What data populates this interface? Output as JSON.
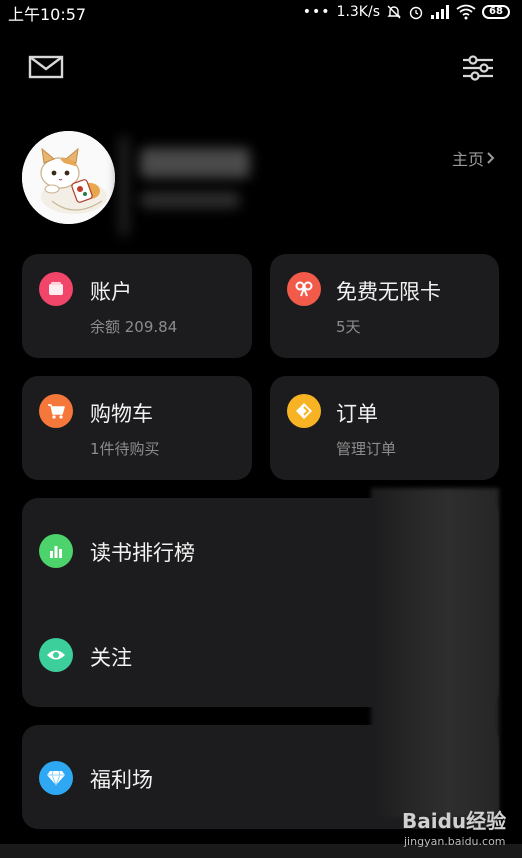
{
  "status_bar": {
    "time": "上午10:57",
    "network_speed": "1.3K/s",
    "battery": "68"
  },
  "header": {
    "homepage_label": "主页"
  },
  "cards": {
    "account": {
      "title": "账户",
      "subtitle": "余额 209.84",
      "color": "#f2456a"
    },
    "free_card": {
      "title": "免费无限卡",
      "subtitle": "5天",
      "color": "#f25a4a"
    },
    "cart": {
      "title": "购物车",
      "subtitle": "1件待购买",
      "color": "#f5773a"
    },
    "orders": {
      "title": "订单",
      "subtitle": "管理订单",
      "color": "#f7b324"
    }
  },
  "list": {
    "ranking": {
      "title": "读书排行榜",
      "color": "#4cd36b"
    },
    "follow": {
      "title": "关注",
      "color": "#3ccf9c"
    },
    "welfare": {
      "title": "福利场",
      "color": "#2ea8f2"
    }
  },
  "watermark": {
    "brand": "Baidu经验",
    "site": "jingyan.baidu.com"
  }
}
